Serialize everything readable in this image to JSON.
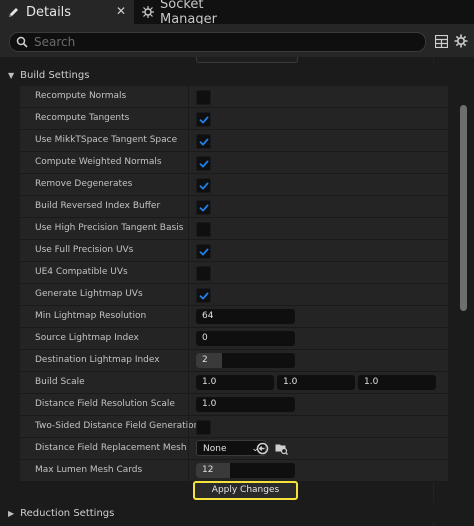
{
  "tabs": {
    "details_label": "Details",
    "socket_manager_label": "Socket Manager",
    "close_glyph": "✕"
  },
  "search": {
    "placeholder": "Search"
  },
  "build_settings": {
    "title": "Build Settings",
    "rows": {
      "recompute_normals": {
        "label": "Recompute Normals",
        "checked": false
      },
      "recompute_tangents": {
        "label": "Recompute Tangents",
        "checked": true
      },
      "use_mikkt": {
        "label": "Use MikkTSpace Tangent Space",
        "checked": true
      },
      "compute_weighted_normals": {
        "label": "Compute Weighted Normals",
        "checked": true
      },
      "remove_degenerates": {
        "label": "Remove Degenerates",
        "checked": true
      },
      "build_reversed_index_buffer": {
        "label": "Build Reversed Index Buffer",
        "checked": true
      },
      "use_high_precision_tangent": {
        "label": "Use High Precision Tangent Basis",
        "checked": false
      },
      "use_full_precision_uvs": {
        "label": "Use Full Precision UVs",
        "checked": true
      },
      "ue4_compatible_uvs": {
        "label": "UE4 Compatible UVs",
        "checked": false
      },
      "generate_lightmap_uvs": {
        "label": "Generate Lightmap UVs",
        "checked": true
      },
      "min_lightmap_resolution": {
        "label": "Min Lightmap Resolution",
        "value": "64"
      },
      "source_lightmap_index": {
        "label": "Source Lightmap Index",
        "value": "0"
      },
      "destination_lightmap_index": {
        "label": "Destination Lightmap Index",
        "value": "2"
      },
      "build_scale": {
        "label": "Build Scale",
        "x": "1.0",
        "y": "1.0",
        "z": "1.0"
      },
      "distance_field_resolution_scale": {
        "label": "Distance Field Resolution Scale",
        "value": "1.0"
      },
      "two_sided_distance_field": {
        "label": "Two-Sided Distance Field Generation",
        "checked": false
      },
      "distance_field_replacement_mesh": {
        "label": "Distance Field Replacement Mesh",
        "value": "None"
      },
      "max_lumen_mesh_cards": {
        "label": "Max Lumen Mesh Cards",
        "value": "12"
      }
    },
    "apply_button": "Apply Changes"
  },
  "reduction_settings": {
    "title": "Reduction Settings"
  },
  "colors": {
    "checkbox_check": "#1f7fe6",
    "apply_border": "#f5e33c",
    "field_bg": "#0f0f0f",
    "row_bg": "#242424"
  },
  "icons": {
    "details_tab": "pencil-icon",
    "socket_manager_tab": "socket-icon",
    "search": "search-icon",
    "table_view": "table-icon",
    "settings": "gear-icon",
    "use_selected": "arrow-left-circle-icon",
    "browse": "folder-search-icon"
  }
}
